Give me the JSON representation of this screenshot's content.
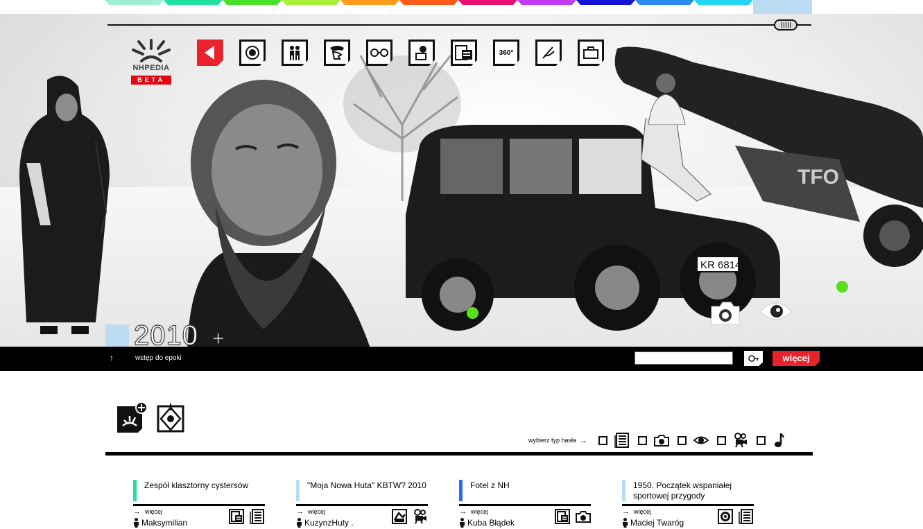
{
  "colors": {
    "tabs": [
      "#9ff0d6",
      "#22e0a0",
      "#49e02a",
      "#a6f03a",
      "#ff9c1a",
      "#ff5a16",
      "#ea0e6e",
      "#c13cf2",
      "#1414d8",
      "#2a8cf0",
      "#25d6f2"
    ],
    "tab_end": "#bcdcf4",
    "accent_red": "#e8232b",
    "green_dot": "#56e01b"
  },
  "logo": {
    "word": "NHPEDIA",
    "badge": "BETA"
  },
  "nav_icons": [
    "back-icon",
    "record-icon",
    "people-icon",
    "face-profile-icon",
    "glasses-icon",
    "photo-album-icon",
    "building-icon",
    "360-icon",
    "document-hand-icon",
    "suitcase-icon"
  ],
  "nav_360_label": "360°",
  "hero": {
    "year": "2010",
    "year_suffix": "+"
  },
  "bar": {
    "intro_link": "wstęp do epoki",
    "search_placeholder": "",
    "more_label": "więcej"
  },
  "filter": {
    "label": "wybierz typ hasła",
    "types": [
      "text-icon",
      "camera-icon",
      "eye-icon",
      "video-camera-icon",
      "music-note-icon"
    ]
  },
  "cards": [
    {
      "title": "Zespół klasztorny cystersów",
      "accent": "#22e0a0",
      "more": "więcej",
      "author": "Maksymilian",
      "types": [
        "building-icon",
        "text-icon"
      ]
    },
    {
      "title": "\"Moja Nowa Huta\" KBTW? 2010",
      "accent": "#bcdcf4",
      "more": "więcej",
      "author": "KuzynzHuty .",
      "types": [
        "photo-album-icon",
        "video-camera-icon"
      ]
    },
    {
      "title": "Fotel z NH",
      "accent": "#2a6cf0",
      "more": "więcej",
      "author": "Kuba Błądek",
      "types": [
        "building-icon",
        "camera-icon"
      ]
    },
    {
      "title": "1950. Początek wspaniałej sportowej przygody",
      "accent": "#bcdcf4",
      "more": "więcej",
      "author": "Maciej Twaróg",
      "types": [
        "record-icon",
        "text-icon"
      ]
    }
  ]
}
